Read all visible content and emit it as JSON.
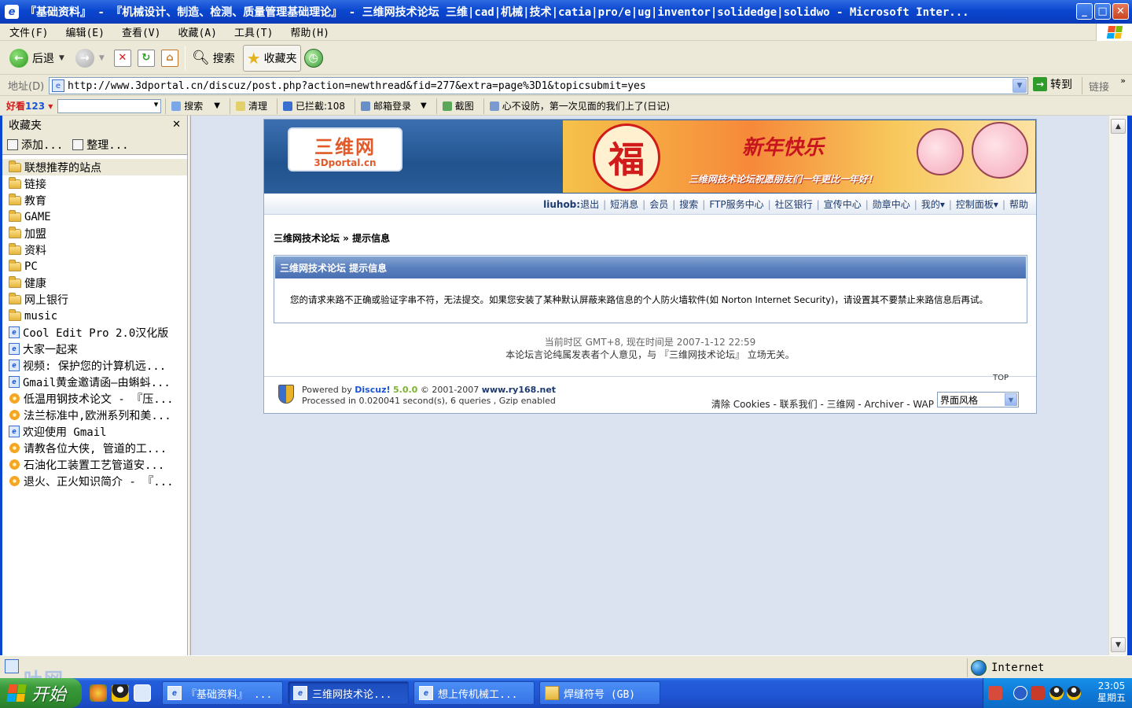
{
  "window": {
    "title": "『基础资料』 - 『机械设计、制造、检测、质量管理基础理论』 - 三维网技术论坛 三维|cad|机械|技术|catia|pro/e|ug|inventor|solidedge|solidwo - Microsoft Inter..."
  },
  "menu": [
    "文件(F)",
    "编辑(E)",
    "查看(V)",
    "收藏(A)",
    "工具(T)",
    "帮助(H)"
  ],
  "toolbar": {
    "back_label": "后退",
    "search_label": "搜索",
    "favorites_label": "收藏夹"
  },
  "address": {
    "label": "地址(D)",
    "url": "http://www.3dportal.cn/discuz/post.php?action=newthread&fid=277&extra=page%3D1&topicsubmit=yes",
    "go_label": "转到",
    "links_label": "链接"
  },
  "extrabar": {
    "logo_a": "好看",
    "logo_b": "123",
    "search": "搜索",
    "clean": "清理",
    "blocked": "已拦截:108",
    "mail": "邮箱登录",
    "screenshot": "截图",
    "news": "心不设防，第一次见面的我们上了(日记)"
  },
  "sidebar": {
    "title": "收藏夹",
    "add_label": "添加...",
    "organize_label": "整理...",
    "items": [
      {
        "type": "folder",
        "label": "联想推荐的站点"
      },
      {
        "type": "folder",
        "label": "链接"
      },
      {
        "type": "folder",
        "label": "教育"
      },
      {
        "type": "folder",
        "label": "GAME"
      },
      {
        "type": "folder",
        "label": "加盟"
      },
      {
        "type": "folder",
        "label": "资料"
      },
      {
        "type": "folder",
        "label": "PC"
      },
      {
        "type": "folder",
        "label": "健康"
      },
      {
        "type": "folder",
        "label": "网上银行"
      },
      {
        "type": "folder",
        "label": "music"
      },
      {
        "type": "page",
        "label": "Cool Edit Pro 2.0汉化版"
      },
      {
        "type": "page",
        "label": "大家一起来"
      },
      {
        "type": "page",
        "label": "视频: 保护您的计算机远..."
      },
      {
        "type": "page",
        "label": "Gmail黄金邀请函—由蝌蚪..."
      },
      {
        "type": "flower",
        "label": "低温用钢技术论文 - 『压..."
      },
      {
        "type": "flower",
        "label": "法兰标准中,欧洲系列和美..."
      },
      {
        "type": "page",
        "label": "欢迎使用 Gmail"
      },
      {
        "type": "flower",
        "label": "请教各位大侠, 管道的工..."
      },
      {
        "type": "flower",
        "label": "石油化工装置工艺管道安..."
      },
      {
        "type": "flower",
        "label": "退火、正火知识简介 - 『..."
      }
    ]
  },
  "forum": {
    "logo_main": "三维网",
    "logo_sub": "3Dportal.cn",
    "banner_fu": "福",
    "banner_newyear": "新年快乐",
    "banner_wish": "三维网技术论坛祝愿朋友们一年更比一年好！",
    "nav": {
      "user": "liuhob:",
      "items": [
        "退出",
        "短消息",
        "会员",
        "搜索",
        "FTP服务中心",
        "社区银行",
        "宣传中心",
        "勋章中心",
        "我的▾",
        "控制面板▾",
        "帮助"
      ]
    },
    "breadcrumb": "三维网技术论坛 » 提示信息",
    "message_title": "三维网技术论坛  提示信息",
    "message_body": "您的请求来路不正确或验证字串不符，无法提交。如果您安装了某种默认屏蔽来路信息的个人防火墙软件(如 Norton Internet Security)，请设置其不要禁止来路信息后再试。",
    "timezone_line": "当前时区 GMT+8, 现在时间是 2007-1-12 22:59",
    "disclaimer_line": "本论坛言论纯属发表者个人意见，与 『三维网技术论坛』 立场无关。",
    "footer": {
      "powered_by": "Powered by",
      "discuz": "Discuz!",
      "version": "5.0.0",
      "copyright": "© 2001-2007",
      "site": "www.ry168.net",
      "processed": "Processed in 0.020041 second(s), 6 queries , Gzip enabled",
      "top": "TOP",
      "links": "清除 Cookies - 联系我们 - 三维网 - Archiver - WAP",
      "style_select": "界面风格"
    }
  },
  "statusbar": {
    "zone": "Internet",
    "watermark": "吐网"
  },
  "taskbar": {
    "start": "开始",
    "tasks": [
      {
        "label": "『基础资料』 ...",
        "active": false,
        "icon": "ie"
      },
      {
        "label": "三维网技术论...",
        "active": true,
        "icon": "ie"
      },
      {
        "label": "想上传机械工...",
        "active": false,
        "icon": "ie"
      },
      {
        "label": "焊缝符号 (GB)",
        "active": false,
        "icon": "folder"
      }
    ],
    "clock_time": "23:05",
    "clock_day": "星期五"
  }
}
